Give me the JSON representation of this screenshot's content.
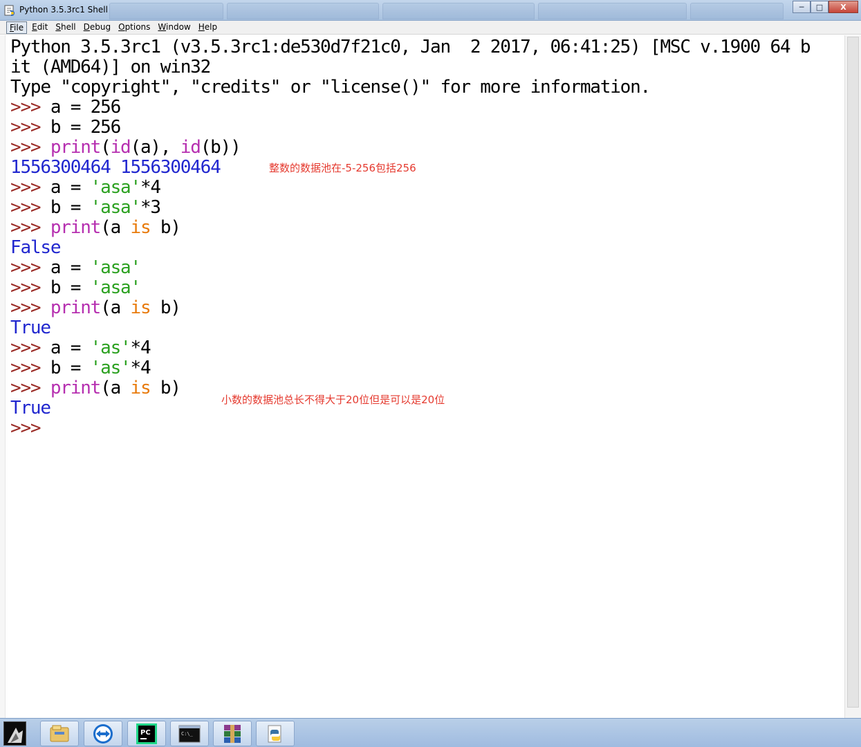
{
  "window": {
    "title": "Python 3.5.3rc1 Shell",
    "buttons": {
      "minimize": "─",
      "maximize": "□",
      "close": "X"
    }
  },
  "menu": [
    "File",
    "Edit",
    "Shell",
    "Debug",
    "Options",
    "Window",
    "Help"
  ],
  "shell": {
    "banner_1": "Python 3.5.3rc1 (v3.5.3rc1:de530d7f21c0, Jan  2 2017, 06:41:25) [MSC v.1900 64 b",
    "banner_2": "it (AMD64)] on win32",
    "banner_3": "Type \"copyright\", \"credits\" or \"license()\" for more information.",
    "prompt": ">>>",
    "line_a1": "a = 256",
    "line_b1": "b = 256",
    "print1": {
      "fn": "print",
      "open": "(",
      "id1": "id",
      "arg1": "(a), ",
      "id2": "id",
      "arg2": "(b))"
    },
    "out1": "1556300464 1556300464",
    "a2": {
      "lhs": "a = ",
      "str": "'asa'",
      "rest": "*4"
    },
    "b2": {
      "lhs": "b = ",
      "str": "'asa'",
      "rest": "*3"
    },
    "print2": {
      "fn": "print",
      "open": "(a ",
      "is": "is",
      "close": " b)"
    },
    "out2": "False",
    "a3": {
      "lhs": "a = ",
      "str": "'asa'"
    },
    "b3": {
      "lhs": "b = ",
      "str": "'asa'"
    },
    "print3": {
      "fn": "print",
      "open": "(a ",
      "is": "is",
      "close": " b)"
    },
    "out3": "True",
    "a4": {
      "lhs": "a = ",
      "str": "'as'",
      "rest": "*4"
    },
    "b4": {
      "lhs": "b = ",
      "str": "'as'",
      "rest": "*4"
    },
    "print4": {
      "fn": "print",
      "open": "(a ",
      "is": "is",
      "close": " b)"
    },
    "out4": "True"
  },
  "annotations": {
    "note1": "整数的数据池在-5-256包括256",
    "note2": "小数的数据池总长不得大于20位但是可以是20位"
  },
  "taskbar": {
    "apps": [
      "start-icon",
      "file-explorer-icon",
      "teamviewer-icon",
      "pycharm-icon",
      "cmd-icon",
      "winrar-icon",
      "python-idle-icon"
    ],
    "pycharm_badge": "PC",
    "cmd_text": "C:\\_"
  },
  "colors": {
    "prompt": "#9b2c27",
    "keyword": "#b62fb0",
    "string": "#2aa01f",
    "operator_keyword": "#e87a0a",
    "output": "#2127cf",
    "annotation": "#e53a2f"
  }
}
